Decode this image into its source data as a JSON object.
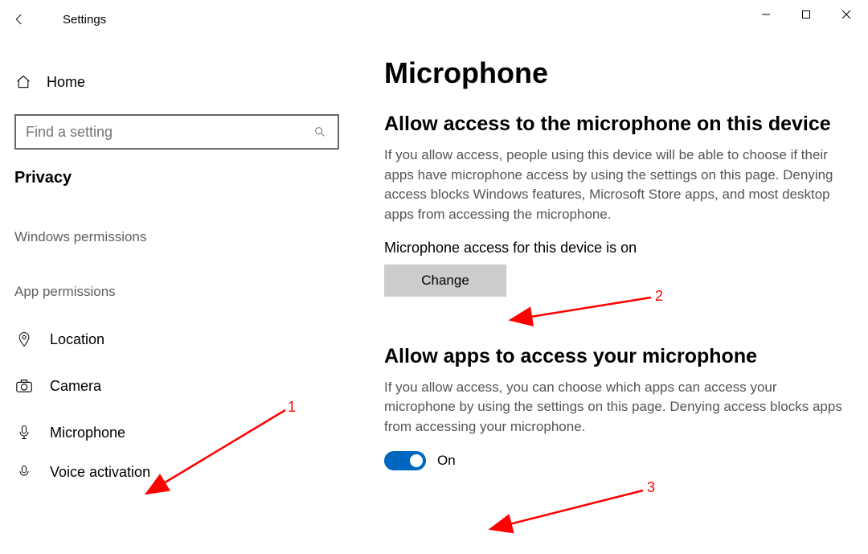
{
  "titlebar": {
    "title": "Settings"
  },
  "sidebar": {
    "home": "Home",
    "search_placeholder": "Find a setting",
    "current_category": "Privacy",
    "group1_label": "Windows permissions",
    "group2_label": "App permissions",
    "items": [
      {
        "label": "Location"
      },
      {
        "label": "Camera"
      },
      {
        "label": "Microphone"
      },
      {
        "label": "Voice activation"
      }
    ]
  },
  "content": {
    "page_title": "Microphone",
    "section1": {
      "heading": "Allow access to the microphone on this device",
      "description": "If you allow access, people using this device will be able to choose if their apps have microphone access by using the settings on this page. Denying access blocks Windows features, Microsoft Store apps, and most desktop apps from accessing the microphone.",
      "status": "Microphone access for this device is on",
      "change_btn": "Change"
    },
    "section2": {
      "heading": "Allow apps to access your microphone",
      "description": "If you allow access, you can choose which apps can access your microphone by using the settings on this page. Denying access blocks apps from accessing your microphone.",
      "toggle_state": "On"
    }
  },
  "annotations": {
    "a1": "1",
    "a2": "2",
    "a3": "3"
  }
}
